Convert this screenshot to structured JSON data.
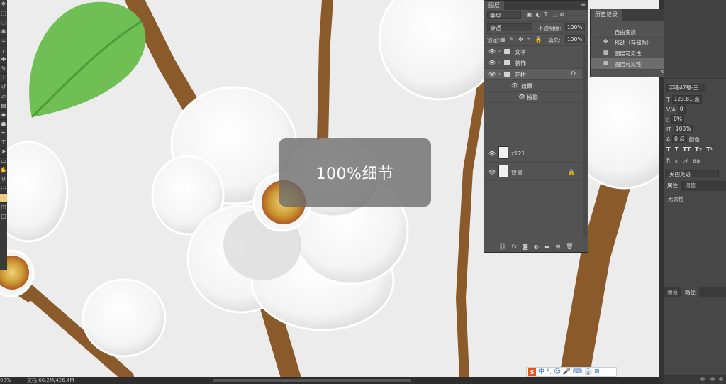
{
  "hud": {
    "zoom_label": "100%细节"
  },
  "status_bar": {
    "zoom": "00%",
    "doc_info": "文档:66.2M/426.4M"
  },
  "layers_panel": {
    "tab": "图层",
    "kind": "类型",
    "blend_mode": "穿透",
    "opacity_label": "不透明度:",
    "opacity": "100%",
    "lock_label": "锁定:",
    "fill_label": "填充:",
    "fill": "100%",
    "layers": [
      {
        "name": "文字",
        "type": "group"
      },
      {
        "name": "装饰",
        "type": "group"
      },
      {
        "name": "花树",
        "type": "group",
        "fx": "fx"
      },
      {
        "name": "效果",
        "type": "effect"
      },
      {
        "name": "投影",
        "type": "effect"
      },
      {
        "name": "z121",
        "type": "pixel"
      },
      {
        "name": "背景",
        "type": "pixel"
      }
    ]
  },
  "history_panel": {
    "tab": "历史记录",
    "items": [
      {
        "label": "自由变换"
      },
      {
        "label": "移动（存储为）"
      },
      {
        "label": "图层可见性"
      },
      {
        "label": "图层可见性"
      }
    ]
  },
  "character_panel": {
    "font": "字魂47号-三...",
    "font_size": "123.81 点",
    "tracking": "0",
    "scale_pct": "0%",
    "vertical_scale": "100%",
    "baseline": "0 点",
    "extra_label": "颜色",
    "language": "美国英语"
  },
  "properties_panel": {
    "tab_active": "属性",
    "tab_other": "调整",
    "body": "无属性"
  },
  "paths_panel": {
    "tab_other": "通道",
    "tab_active": "路径"
  },
  "ime": {
    "items": [
      "中",
      "°,",
      "☺",
      "🎤",
      "⌨",
      "👔",
      "⊞"
    ]
  }
}
